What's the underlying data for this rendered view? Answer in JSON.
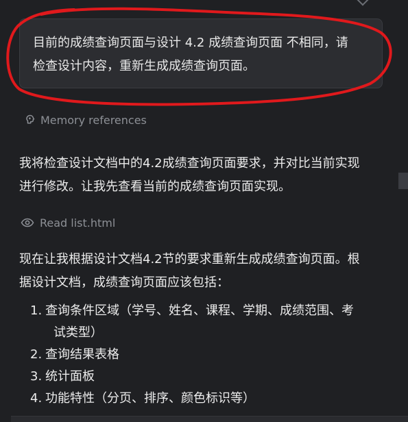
{
  "user_message": {
    "line1": "目前的成绩查询页面与设计 4.2 成绩查询页面 不相同，请",
    "line2": "检查设计内容，重新生成成绩查询页面。"
  },
  "memory_references_label": "Memory references",
  "assistant": {
    "paragraph1_line1": "我将检查设计文档中的4.2成绩查询页面要求，并对比当前实现",
    "paragraph1_line2": "进行修改。让我先查看当前的成绩查询页面实现。",
    "read_file_label": "Read list.html",
    "paragraph2_line1": "现在让我根据设计文档4.2节的要求重新生成成绩查询页面。根",
    "paragraph2_line2": "据设计文档，成绩查询页面应该包括：",
    "steps": [
      {
        "num": "1.",
        "line1": "查询条件区域（学号、姓名、课程、学期、成绩范围、考",
        "line2": "试类型）"
      },
      {
        "num": "2.",
        "line1": "查询结果表格",
        "line2": ""
      },
      {
        "num": "3.",
        "line1": "统计面板",
        "line2": ""
      },
      {
        "num": "4.",
        "line1": "功能特性（分页、排序、颜色标识等）",
        "line2": ""
      }
    ]
  },
  "colors": {
    "background": "#1f2023",
    "bubble": "#2c2d31",
    "annotation_red": "#e0191c",
    "muted_text": "#8d9096"
  },
  "icons": [
    "brain-icon",
    "eye-icon"
  ]
}
